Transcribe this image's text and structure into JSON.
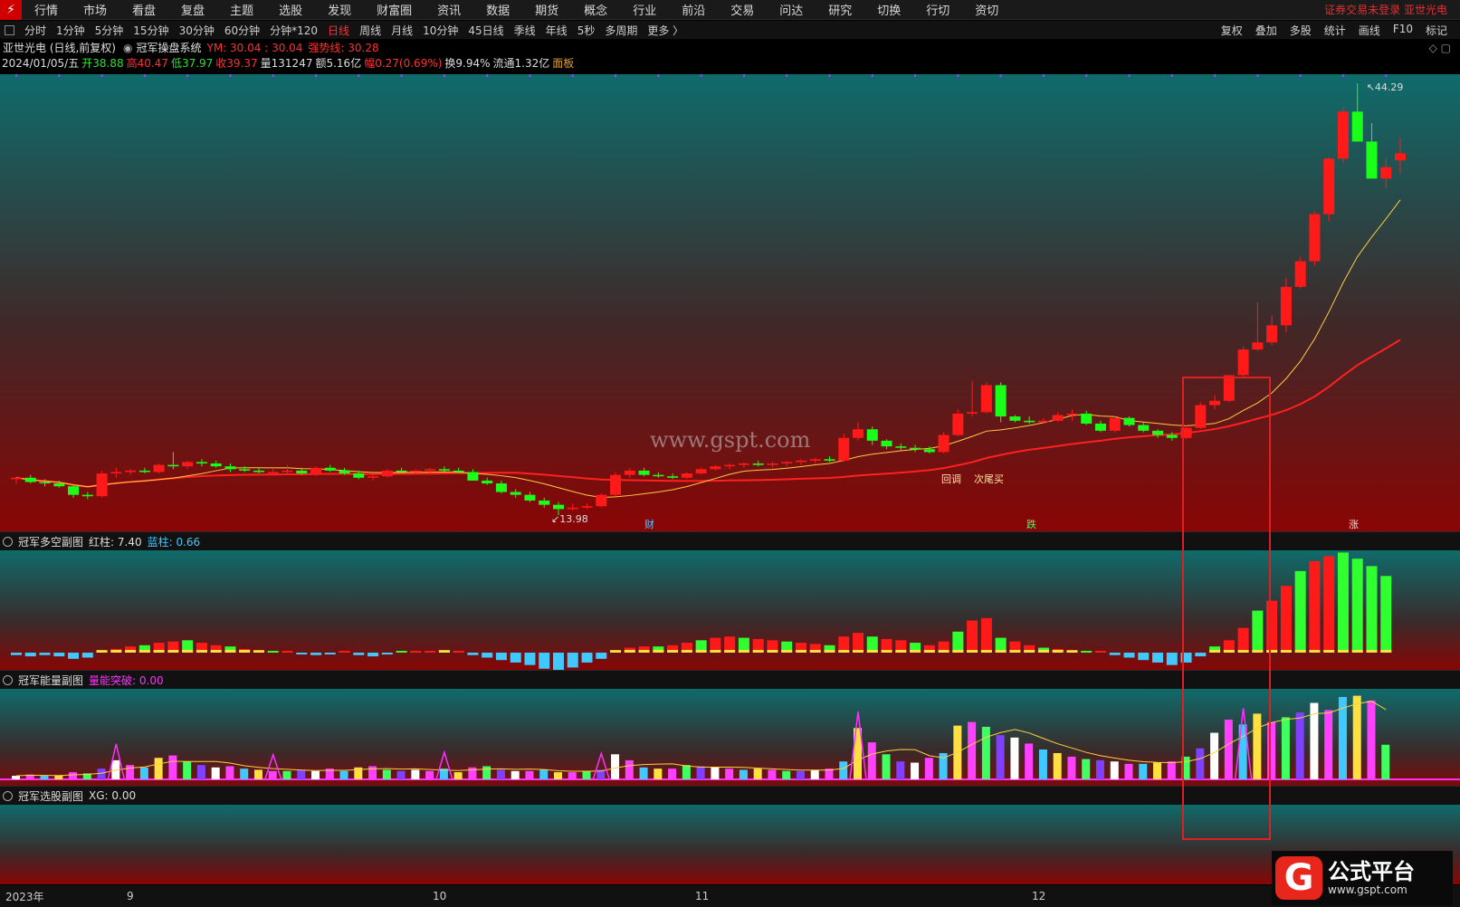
{
  "menu": {
    "items": [
      "行情",
      "市场",
      "看盘",
      "复盘",
      "主题",
      "选股",
      "发现",
      "财富圈",
      "资讯",
      "数据",
      "期货",
      "概念",
      "行业",
      "前沿",
      "交易",
      "问达",
      "研究",
      "切换",
      "行切",
      "资切"
    ],
    "notice": "证券交易未登录  亚世光电"
  },
  "periods": [
    "分时",
    "1分钟",
    "5分钟",
    "15分钟",
    "30分钟",
    "60分钟",
    "分钟*120",
    "日线",
    "周线",
    "月线",
    "10分钟",
    "45日线",
    "季线",
    "年线",
    "5秒",
    "多周期",
    "更多 〉"
  ],
  "active_period": "日线",
  "tools": [
    "复权",
    "叠加",
    "多股",
    "统计",
    "画线",
    "F10",
    "标记"
  ],
  "header": {
    "stock": "亚世光电 (日线,前复权)",
    "system": "冠军操盘系统",
    "ym": "YM: 30.04 : 30.04",
    "strong": "强势线: 30.28",
    "date": "2024/01/05/五",
    "open": "开38.88",
    "high": "高40.47",
    "low": "低37.97",
    "close": "收39.37",
    "volume": "量131247",
    "amount": "额5.16亿",
    "amp": "幅0.27(0.69%)",
    "turnover": "换9.94%",
    "float": "流通1.32亿",
    "board": "面板"
  },
  "main_chart": {
    "max_label": "44.29",
    "min_label": "13.98",
    "annotations": [
      "回调",
      "次尾买"
    ],
    "event_markers": [
      "财",
      "跌",
      "涨"
    ],
    "watermark": "www.gspt.com"
  },
  "panels": {
    "p1": {
      "title": "冠军多空副图",
      "red_label": "红柱: 7.40",
      "blue_label": "蓝柱: 0.66"
    },
    "p2": {
      "title": "冠军能量副图",
      "label": "量能突破: 0.00"
    },
    "p3": {
      "title": "冠军选股副图",
      "label": "XG: 0.00"
    }
  },
  "time_axis": [
    "2023年",
    "9",
    "10",
    "11",
    "12"
  ],
  "logo": {
    "mark": "G",
    "name": "公式平台",
    "url": "www.gspt.com"
  },
  "chart_data": {
    "type": "candlestick",
    "title": "亚世光电 (日线,前复权)",
    "ylim": [
      13.98,
      44.29
    ],
    "candles": [
      [
        16.5,
        16.7,
        16.2,
        16.6
      ],
      [
        16.6,
        16.8,
        16.2,
        16.3
      ],
      [
        16.3,
        16.5,
        16.0,
        16.2
      ],
      [
        16.2,
        16.4,
        15.9,
        16.0
      ],
      [
        16.0,
        16.1,
        15.2,
        15.4
      ],
      [
        15.4,
        15.6,
        15.1,
        15.3
      ],
      [
        15.3,
        17.1,
        15.2,
        16.9
      ],
      [
        16.9,
        17.3,
        16.6,
        17.0
      ],
      [
        17.0,
        17.2,
        16.8,
        17.1
      ],
      [
        17.1,
        17.3,
        16.9,
        17.0
      ],
      [
        17.0,
        17.6,
        16.9,
        17.5
      ],
      [
        17.5,
        18.4,
        17.2,
        17.4
      ],
      [
        17.4,
        17.8,
        17.2,
        17.7
      ],
      [
        17.7,
        17.9,
        17.4,
        17.6
      ],
      [
        17.6,
        17.8,
        17.3,
        17.4
      ],
      [
        17.4,
        17.6,
        17.0,
        17.2
      ],
      [
        17.2,
        17.4,
        17.0,
        17.1
      ],
      [
        17.1,
        17.3,
        16.9,
        17.0
      ],
      [
        17.0,
        17.2,
        16.8,
        17.0
      ],
      [
        17.0,
        17.5,
        16.9,
        17.1
      ],
      [
        17.1,
        17.3,
        16.8,
        16.9
      ],
      [
        16.9,
        17.4,
        16.7,
        17.3
      ],
      [
        17.3,
        17.5,
        17.0,
        17.1
      ],
      [
        17.1,
        17.3,
        16.8,
        16.9
      ],
      [
        16.9,
        17.1,
        16.5,
        16.6
      ],
      [
        16.6,
        16.8,
        16.4,
        16.7
      ],
      [
        16.7,
        17.2,
        16.6,
        17.1
      ],
      [
        17.1,
        17.3,
        16.9,
        17.0
      ],
      [
        17.0,
        17.2,
        16.8,
        17.1
      ],
      [
        17.1,
        17.3,
        16.9,
        17.2
      ],
      [
        17.2,
        17.4,
        17.0,
        17.1
      ],
      [
        17.1,
        17.3,
        16.9,
        17.0
      ],
      [
        17.0,
        17.2,
        16.5,
        16.4
      ],
      [
        16.4,
        16.6,
        16.1,
        16.2
      ],
      [
        16.2,
        16.4,
        15.5,
        15.6
      ],
      [
        15.6,
        15.8,
        15.2,
        15.4
      ],
      [
        15.4,
        15.6,
        14.9,
        15.0
      ],
      [
        15.0,
        15.2,
        14.5,
        14.7
      ],
      [
        14.7,
        14.9,
        13.98,
        14.4
      ],
      [
        14.4,
        14.8,
        14.3,
        14.5
      ],
      [
        14.5,
        14.8,
        14.4,
        14.6
      ],
      [
        14.6,
        15.5,
        14.5,
        15.4
      ],
      [
        15.4,
        17.0,
        15.3,
        16.8
      ],
      [
        16.8,
        17.3,
        16.6,
        17.1
      ],
      [
        17.1,
        17.3,
        16.7,
        16.8
      ],
      [
        16.8,
        17.0,
        16.6,
        16.7
      ],
      [
        16.7,
        16.9,
        16.5,
        16.6
      ],
      [
        16.6,
        17.0,
        16.5,
        16.9
      ],
      [
        16.9,
        17.3,
        16.8,
        17.2
      ],
      [
        17.2,
        17.5,
        17.1,
        17.4
      ],
      [
        17.4,
        17.6,
        17.2,
        17.5
      ],
      [
        17.5,
        17.7,
        17.3,
        17.6
      ],
      [
        17.6,
        17.8,
        17.4,
        17.5
      ],
      [
        17.5,
        17.7,
        17.3,
        17.6
      ],
      [
        17.6,
        17.8,
        17.4,
        17.7
      ],
      [
        17.7,
        17.9,
        17.5,
        17.8
      ],
      [
        17.8,
        18.0,
        17.6,
        17.9
      ],
      [
        17.9,
        18.1,
        17.7,
        17.8
      ],
      [
        17.8,
        19.7,
        17.7,
        19.4
      ],
      [
        19.4,
        20.5,
        19.2,
        20.0
      ],
      [
        20.0,
        20.2,
        18.9,
        19.2
      ],
      [
        19.2,
        19.3,
        18.6,
        18.8
      ],
      [
        18.8,
        19.0,
        18.5,
        18.7
      ],
      [
        18.7,
        18.9,
        18.4,
        18.6
      ],
      [
        18.6,
        18.8,
        18.3,
        18.4
      ],
      [
        18.4,
        19.8,
        18.3,
        19.6
      ],
      [
        19.6,
        21.4,
        19.5,
        21.1
      ],
      [
        21.1,
        23.4,
        20.9,
        21.2
      ],
      [
        21.2,
        23.3,
        21.1,
        23.1
      ],
      [
        23.1,
        23.3,
        20.5,
        20.9
      ],
      [
        20.9,
        21.0,
        20.5,
        20.6
      ],
      [
        20.6,
        20.9,
        20.4,
        20.5
      ],
      [
        20.5,
        20.8,
        20.4,
        20.6
      ],
      [
        20.6,
        21.2,
        20.5,
        21.0
      ],
      [
        21.0,
        21.4,
        20.6,
        21.1
      ],
      [
        21.1,
        21.3,
        20.3,
        20.4
      ],
      [
        20.4,
        20.6,
        19.8,
        19.9
      ],
      [
        19.9,
        20.9,
        19.8,
        20.8
      ],
      [
        20.8,
        20.9,
        20.2,
        20.3
      ],
      [
        20.3,
        20.5,
        19.8,
        19.9
      ],
      [
        19.9,
        20.0,
        19.4,
        19.6
      ],
      [
        19.6,
        19.8,
        19.2,
        19.4
      ],
      [
        19.4,
        20.3,
        19.3,
        20.1
      ],
      [
        20.1,
        21.9,
        20.0,
        21.7
      ],
      [
        21.7,
        22.4,
        21.4,
        22.0
      ],
      [
        22.0,
        23.0,
        21.9,
        23.8
      ],
      [
        23.8,
        25.8,
        23.7,
        25.6
      ],
      [
        25.6,
        28.9,
        25.5,
        26.1
      ],
      [
        26.1,
        28.0,
        25.9,
        27.3
      ],
      [
        27.3,
        30.6,
        26.8,
        30.0
      ],
      [
        30.0,
        32.1,
        29.9,
        31.8
      ],
      [
        31.8,
        35.3,
        31.5,
        35.1
      ],
      [
        35.1,
        39.1,
        34.6,
        39.0
      ],
      [
        39.0,
        42.6,
        38.7,
        42.3
      ],
      [
        42.3,
        44.29,
        41.8,
        40.2
      ],
      [
        40.2,
        41.5,
        37.6,
        37.6
      ],
      [
        37.6,
        39.0,
        36.9,
        38.4
      ],
      [
        38.88,
        40.47,
        37.97,
        39.37
      ]
    ],
    "ma_short_label": "强势线",
    "long_line": "red",
    "panel1_values": [
      -0.2,
      -0.3,
      -0.2,
      -0.3,
      -0.5,
      -0.4,
      0.2,
      0.3,
      0.5,
      0.6,
      0.8,
      0.9,
      1.0,
      0.8,
      0.6,
      0.5,
      0.3,
      0.2,
      0.1,
      0.1,
      -0.1,
      -0.2,
      -0.1,
      0.0,
      -0.2,
      -0.3,
      -0.1,
      0.1,
      0.0,
      0.1,
      0.2,
      0.1,
      -0.2,
      -0.4,
      -0.6,
      -0.8,
      -1.0,
      -1.3,
      -1.5,
      -1.2,
      -0.8,
      -0.5,
      0.2,
      0.4,
      0.5,
      0.5,
      0.6,
      0.8,
      1.0,
      1.2,
      1.3,
      1.2,
      1.1,
      1.0,
      0.9,
      0.8,
      0.7,
      0.6,
      1.3,
      1.6,
      1.3,
      1.1,
      1.0,
      0.8,
      0.6,
      0.9,
      1.7,
      2.6,
      2.8,
      1.2,
      0.9,
      0.6,
      0.4,
      0.3,
      0.2,
      0.1,
      0.0,
      -0.2,
      -0.4,
      -0.6,
      -0.8,
      -1.0,
      -0.8,
      -0.3,
      0.5,
      1.0,
      2.0,
      3.4,
      4.2,
      5.4,
      6.6,
      7.4,
      7.8,
      8.1,
      7.6,
      7.0,
      6.2
    ],
    "panel2_values": [
      0.3,
      0.4,
      0.3,
      0.3,
      0.6,
      0.5,
      0.9,
      1.6,
      1.2,
      1.0,
      1.8,
      2.0,
      1.5,
      1.2,
      1.0,
      1.1,
      0.9,
      0.8,
      0.7,
      0.7,
      0.8,
      0.7,
      0.9,
      0.7,
      1.0,
      1.1,
      0.8,
      0.7,
      0.8,
      0.7,
      0.9,
      0.6,
      1.0,
      1.1,
      0.8,
      0.7,
      0.7,
      0.8,
      0.6,
      0.6,
      0.7,
      0.8,
      2.1,
      1.6,
      1.0,
      0.9,
      0.9,
      1.2,
      1.1,
      1.0,
      0.9,
      0.8,
      0.9,
      0.8,
      0.7,
      0.7,
      0.8,
      0.9,
      1.5,
      4.3,
      3.1,
      2.1,
      1.5,
      1.4,
      1.8,
      2.2,
      4.5,
      4.8,
      4.4,
      3.7,
      3.5,
      3.0,
      2.5,
      2.2,
      1.9,
      1.7,
      1.6,
      1.5,
      1.3,
      1.3,
      1.4,
      1.5,
      1.9,
      2.6,
      3.9,
      5.0,
      4.6,
      5.5,
      4.8,
      5.2,
      5.6,
      6.4,
      5.8,
      6.9,
      7.0,
      6.6,
      2.9
    ]
  }
}
